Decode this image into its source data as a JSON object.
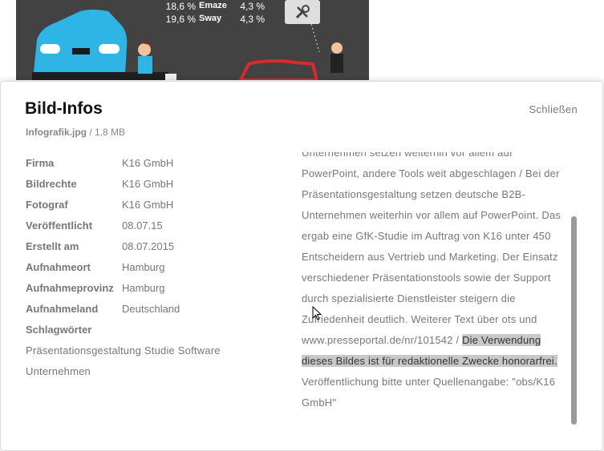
{
  "background": {
    "stats": [
      {
        "pct": "18,6 %",
        "name": "Emaze",
        "pct2": "4,3 %"
      },
      {
        "pct": "19,6 %",
        "name": "Sway",
        "pct2": "4,3 %"
      }
    ],
    "tools_icon": "tools-icon"
  },
  "modal": {
    "title": "Bild-Infos",
    "close_label": "Schließen",
    "file_name": "Infografik.jpg",
    "file_size": " / 1,8 MB",
    "meta": [
      {
        "key": "Firma",
        "value": "K16 GmbH"
      },
      {
        "key": "Bildrechte",
        "value": "K16 GmbH"
      },
      {
        "key": "Fotograf",
        "value": "K16 GmbH"
      },
      {
        "key": "Veröffentlicht",
        "value": "08.07.15"
      },
      {
        "key": "Erstellt am",
        "value": "08.07.2015"
      },
      {
        "key": "Aufnahmeort",
        "value": "Hamburg"
      },
      {
        "key": "Aufnahmeprovinz",
        "value": "Hamburg"
      },
      {
        "key": "Aufnahmeland",
        "value": "Deutschland"
      },
      {
        "key": "Schlagwörter",
        "value": ""
      }
    ],
    "keywords": "Präsentationsgestaltung Studie Software Unternehmen",
    "description_part1": "Unternehmen setzen weiterhin vor allem auf PowerPoint, andere Tools weit abgeschlagen / Bei der Präsentationsgestaltung setzen deutsche B2B-Unternehmen weiterhin vor allem auf PowerPoint. Das ergab eine GfK-Studie im Auftrag von K16 unter 450 Entscheidern aus Vertrieb und Marketing. Der Einsatz verschiedener Präsentationstools sowie der Support durch spezialisierte Dienstleister steigern die Zufriedenheit deutlich. Weiterer Text über ots und www.presseportal.de/nr/101542 / ",
    "description_highlight": "Die Verwendung dieses Bildes ist für redaktionelle Zwecke honorarfrei.",
    "description_part2": " Veröffentlichung bitte unter Quellenangabe: \"obs/K16 GmbH\""
  }
}
